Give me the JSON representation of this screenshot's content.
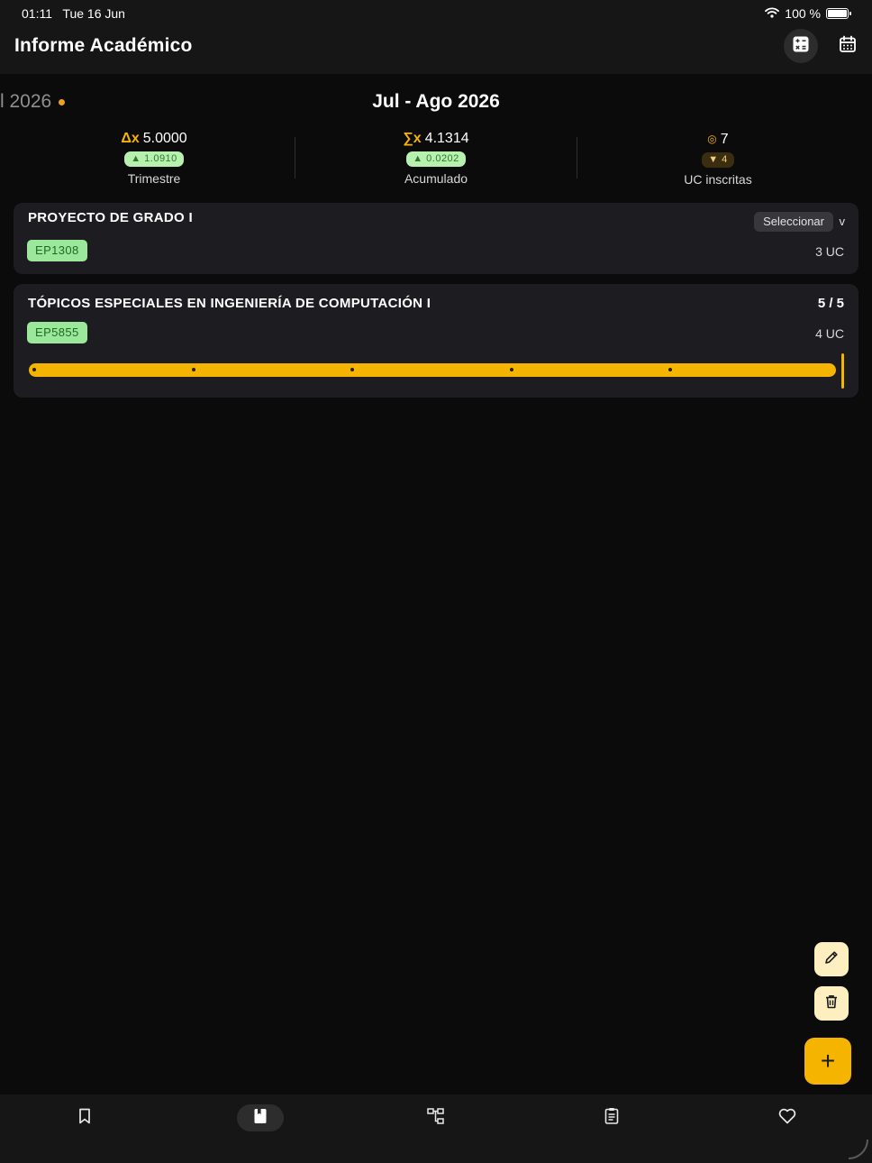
{
  "status_bar": {
    "time": "01:11",
    "date": "Tue 16 Jun",
    "battery": "100 %"
  },
  "header": {
    "title": "Informe Académico",
    "calculator_icon": "calculator-icon",
    "calendar_icon": "calendar-icon"
  },
  "periods": {
    "previous_partial": "l 2026",
    "current": "Jul - Ago 2026"
  },
  "stats": [
    {
      "symbol": "Δx",
      "value": "5.0000",
      "badge": "▲ 1.0910",
      "trend": "up",
      "label": "Trimestre"
    },
    {
      "symbol": "∑x",
      "value": "4.1314",
      "badge": "▲ 0.0202",
      "trend": "up",
      "label": "Acumulado"
    },
    {
      "symbol": "◎",
      "value": "7",
      "badge": "▼ 4",
      "trend": "down",
      "label": "UC inscritas"
    }
  ],
  "courses": [
    {
      "title": "PROYECTO DE GRADO I",
      "code": "EP1308",
      "credits": "3 UC",
      "select_label": "Seleccionar",
      "select_chevron": "v"
    },
    {
      "title": "TÓPICOS ESPECIALES EN INGENIERÍA DE COMPUTACIÓN I",
      "code": "EP5855",
      "credits": "4 UC",
      "grade": "5 / 5",
      "slider": {
        "min": 1,
        "max": 5,
        "value": 5,
        "ticks": [
          1,
          2,
          3,
          4,
          5
        ]
      }
    }
  ],
  "actions": {
    "edit_icon": "pencil-icon",
    "delete_icon": "trash-icon",
    "add_label": "+"
  },
  "bottom_nav": [
    {
      "name": "bookmark",
      "icon": "bookmark-icon",
      "active": false
    },
    {
      "name": "book",
      "icon": "book-icon",
      "active": true
    },
    {
      "name": "hierarchy",
      "icon": "hierarchy-icon",
      "active": false
    },
    {
      "name": "clipboard",
      "icon": "clipboard-icon",
      "active": false
    },
    {
      "name": "favorites",
      "icon": "heart-icon",
      "active": false
    }
  ],
  "colors": {
    "accent": "#f5b400",
    "background": "#0b0b0b",
    "card": "#1d1c21",
    "code_badge": "#9be89a",
    "trend_up": "#b8f0b0",
    "trend_down": "#3b2e10"
  }
}
